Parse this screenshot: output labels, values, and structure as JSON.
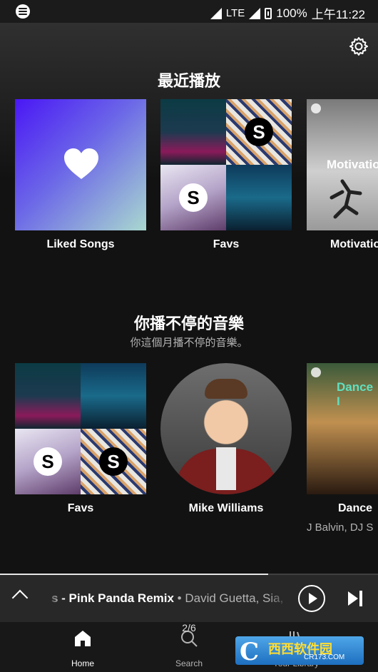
{
  "status_bar": {
    "network": "LTE",
    "battery": "100%",
    "time": "上午11:22"
  },
  "recently_played": {
    "title": "最近播放",
    "items": [
      {
        "label": "Liked Songs"
      },
      {
        "label": "Favs"
      },
      {
        "label": "Motivatio",
        "cover_text": "Motivatio"
      }
    ]
  },
  "on_repeat": {
    "title": "你播不停的音樂",
    "subtitle": "你這個月播不停的音樂。",
    "items": [
      {
        "label": "Favs"
      },
      {
        "label": "Mike Williams"
      },
      {
        "label": "Dance",
        "cover_text": "Dance I",
        "sublabel": "J Balvin, DJ S"
      }
    ]
  },
  "player": {
    "track": "s - Pink Panda Remix",
    "separator": " • ",
    "artists": "David Guetta, Sia, P",
    "progress": 0.71
  },
  "bottom_nav": {
    "home": "Home",
    "search": "Search",
    "library": "Your Library"
  },
  "pager": "2/6",
  "watermark": {
    "brand_letter": "C",
    "brand_text": "西西软件园",
    "url": "CR173.COM"
  }
}
